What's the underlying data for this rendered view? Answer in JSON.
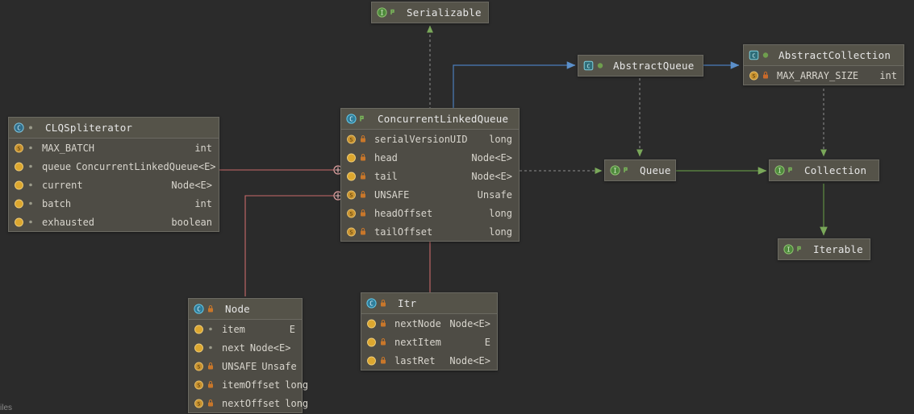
{
  "diagram": {
    "kind": "uml-class-diagram",
    "background_color": "#2b2b2b",
    "node_fill": "#4e4c45",
    "node_header_fill": "#555349",
    "node_border": "#6b6a62",
    "edge_colors": {
      "inheritance_blue": "#4a7ebb",
      "realization_green": "#6d9e4c",
      "association_red": "#c96a6a",
      "dependency_gray": "#8c8c8c"
    },
    "corner_text": "iles"
  },
  "nodes": {
    "clq_spliterator": {
      "name": "CLQSpliterator",
      "icon": "class-icon",
      "visibility_icon": "package-private-icon",
      "members": [
        {
          "name": "MAX_BATCH",
          "type": "int",
          "icon": "static-field-icon",
          "visibility": "package-private-icon"
        },
        {
          "name": "queue",
          "type": "ConcurrentLinkedQueue<E>",
          "icon": "field-icon",
          "visibility": "package-private-icon",
          "inline": true
        },
        {
          "name": "current",
          "type": "Node<E>",
          "icon": "field-icon",
          "visibility": "package-private-icon"
        },
        {
          "name": "batch",
          "type": "int",
          "icon": "field-icon",
          "visibility": "package-private-icon"
        },
        {
          "name": "exhausted",
          "type": "boolean",
          "icon": "field-icon",
          "visibility": "package-private-icon"
        }
      ]
    },
    "concurrent_linked_queue": {
      "name": "ConcurrentLinkedQueue",
      "icon": "class-icon",
      "visibility_icon": "public-icon",
      "members": [
        {
          "name": "serialVersionUID",
          "type": "long",
          "icon": "static-field-icon",
          "visibility": "private-icon"
        },
        {
          "name": "head",
          "type": "Node<E>",
          "icon": "field-icon",
          "visibility": "private-icon"
        },
        {
          "name": "tail",
          "type": "Node<E>",
          "icon": "field-icon",
          "visibility": "private-icon"
        },
        {
          "name": "UNSAFE",
          "type": "Unsafe",
          "icon": "static-field-icon",
          "visibility": "private-icon"
        },
        {
          "name": "headOffset",
          "type": "long",
          "icon": "static-field-icon",
          "visibility": "private-icon"
        },
        {
          "name": "tailOffset",
          "type": "long",
          "icon": "static-field-icon",
          "visibility": "private-icon"
        }
      ]
    },
    "node_class": {
      "name": "Node",
      "icon": "class-icon",
      "visibility_icon": "private-icon",
      "members": [
        {
          "name": "item",
          "type": "E",
          "icon": "field-icon",
          "visibility": "package-private-icon"
        },
        {
          "name": "next",
          "type": "Node<E>",
          "icon": "field-icon",
          "visibility": "package-private-icon",
          "inline": true
        },
        {
          "name": "UNSAFE",
          "type": "Unsafe",
          "icon": "static-field-icon",
          "visibility": "private-icon",
          "inline": true
        },
        {
          "name": "itemOffset",
          "type": "long",
          "icon": "static-field-icon",
          "visibility": "private-icon",
          "inline": true
        },
        {
          "name": "nextOffset",
          "type": "long",
          "icon": "static-field-icon",
          "visibility": "private-icon",
          "inline": true
        }
      ]
    },
    "itr": {
      "name": "Itr",
      "icon": "class-icon",
      "visibility_icon": "private-icon",
      "members": [
        {
          "name": "nextNode",
          "type": "Node<E>",
          "icon": "field-icon",
          "visibility": "private-icon"
        },
        {
          "name": "nextItem",
          "type": "E",
          "icon": "field-icon",
          "visibility": "private-icon"
        },
        {
          "name": "lastRet",
          "type": "Node<E>",
          "icon": "field-icon",
          "visibility": "private-icon"
        }
      ]
    },
    "serializable": {
      "name": "Serializable",
      "icon": "interface-icon",
      "visibility_icon": "public-interface-icon",
      "members": []
    },
    "abstract_queue": {
      "name": "AbstractQueue",
      "icon": "abstract-class-icon",
      "visibility_icon": "public-icon",
      "members": []
    },
    "abstract_collection": {
      "name": "AbstractCollection",
      "icon": "abstract-class-icon",
      "visibility_icon": "public-icon",
      "members": [
        {
          "name": "MAX_ARRAY_SIZE",
          "type": "int",
          "icon": "static-field-icon",
          "visibility": "package-private-icon"
        }
      ]
    },
    "queue": {
      "name": "Queue",
      "icon": "interface-icon",
      "visibility_icon": "public-interface-icon",
      "members": []
    },
    "collection": {
      "name": "Collection",
      "icon": "interface-icon",
      "visibility_icon": "public-interface-icon",
      "members": []
    },
    "iterable": {
      "name": "Iterable",
      "icon": "interface-icon",
      "visibility_icon": "public-interface-icon",
      "members": []
    }
  }
}
